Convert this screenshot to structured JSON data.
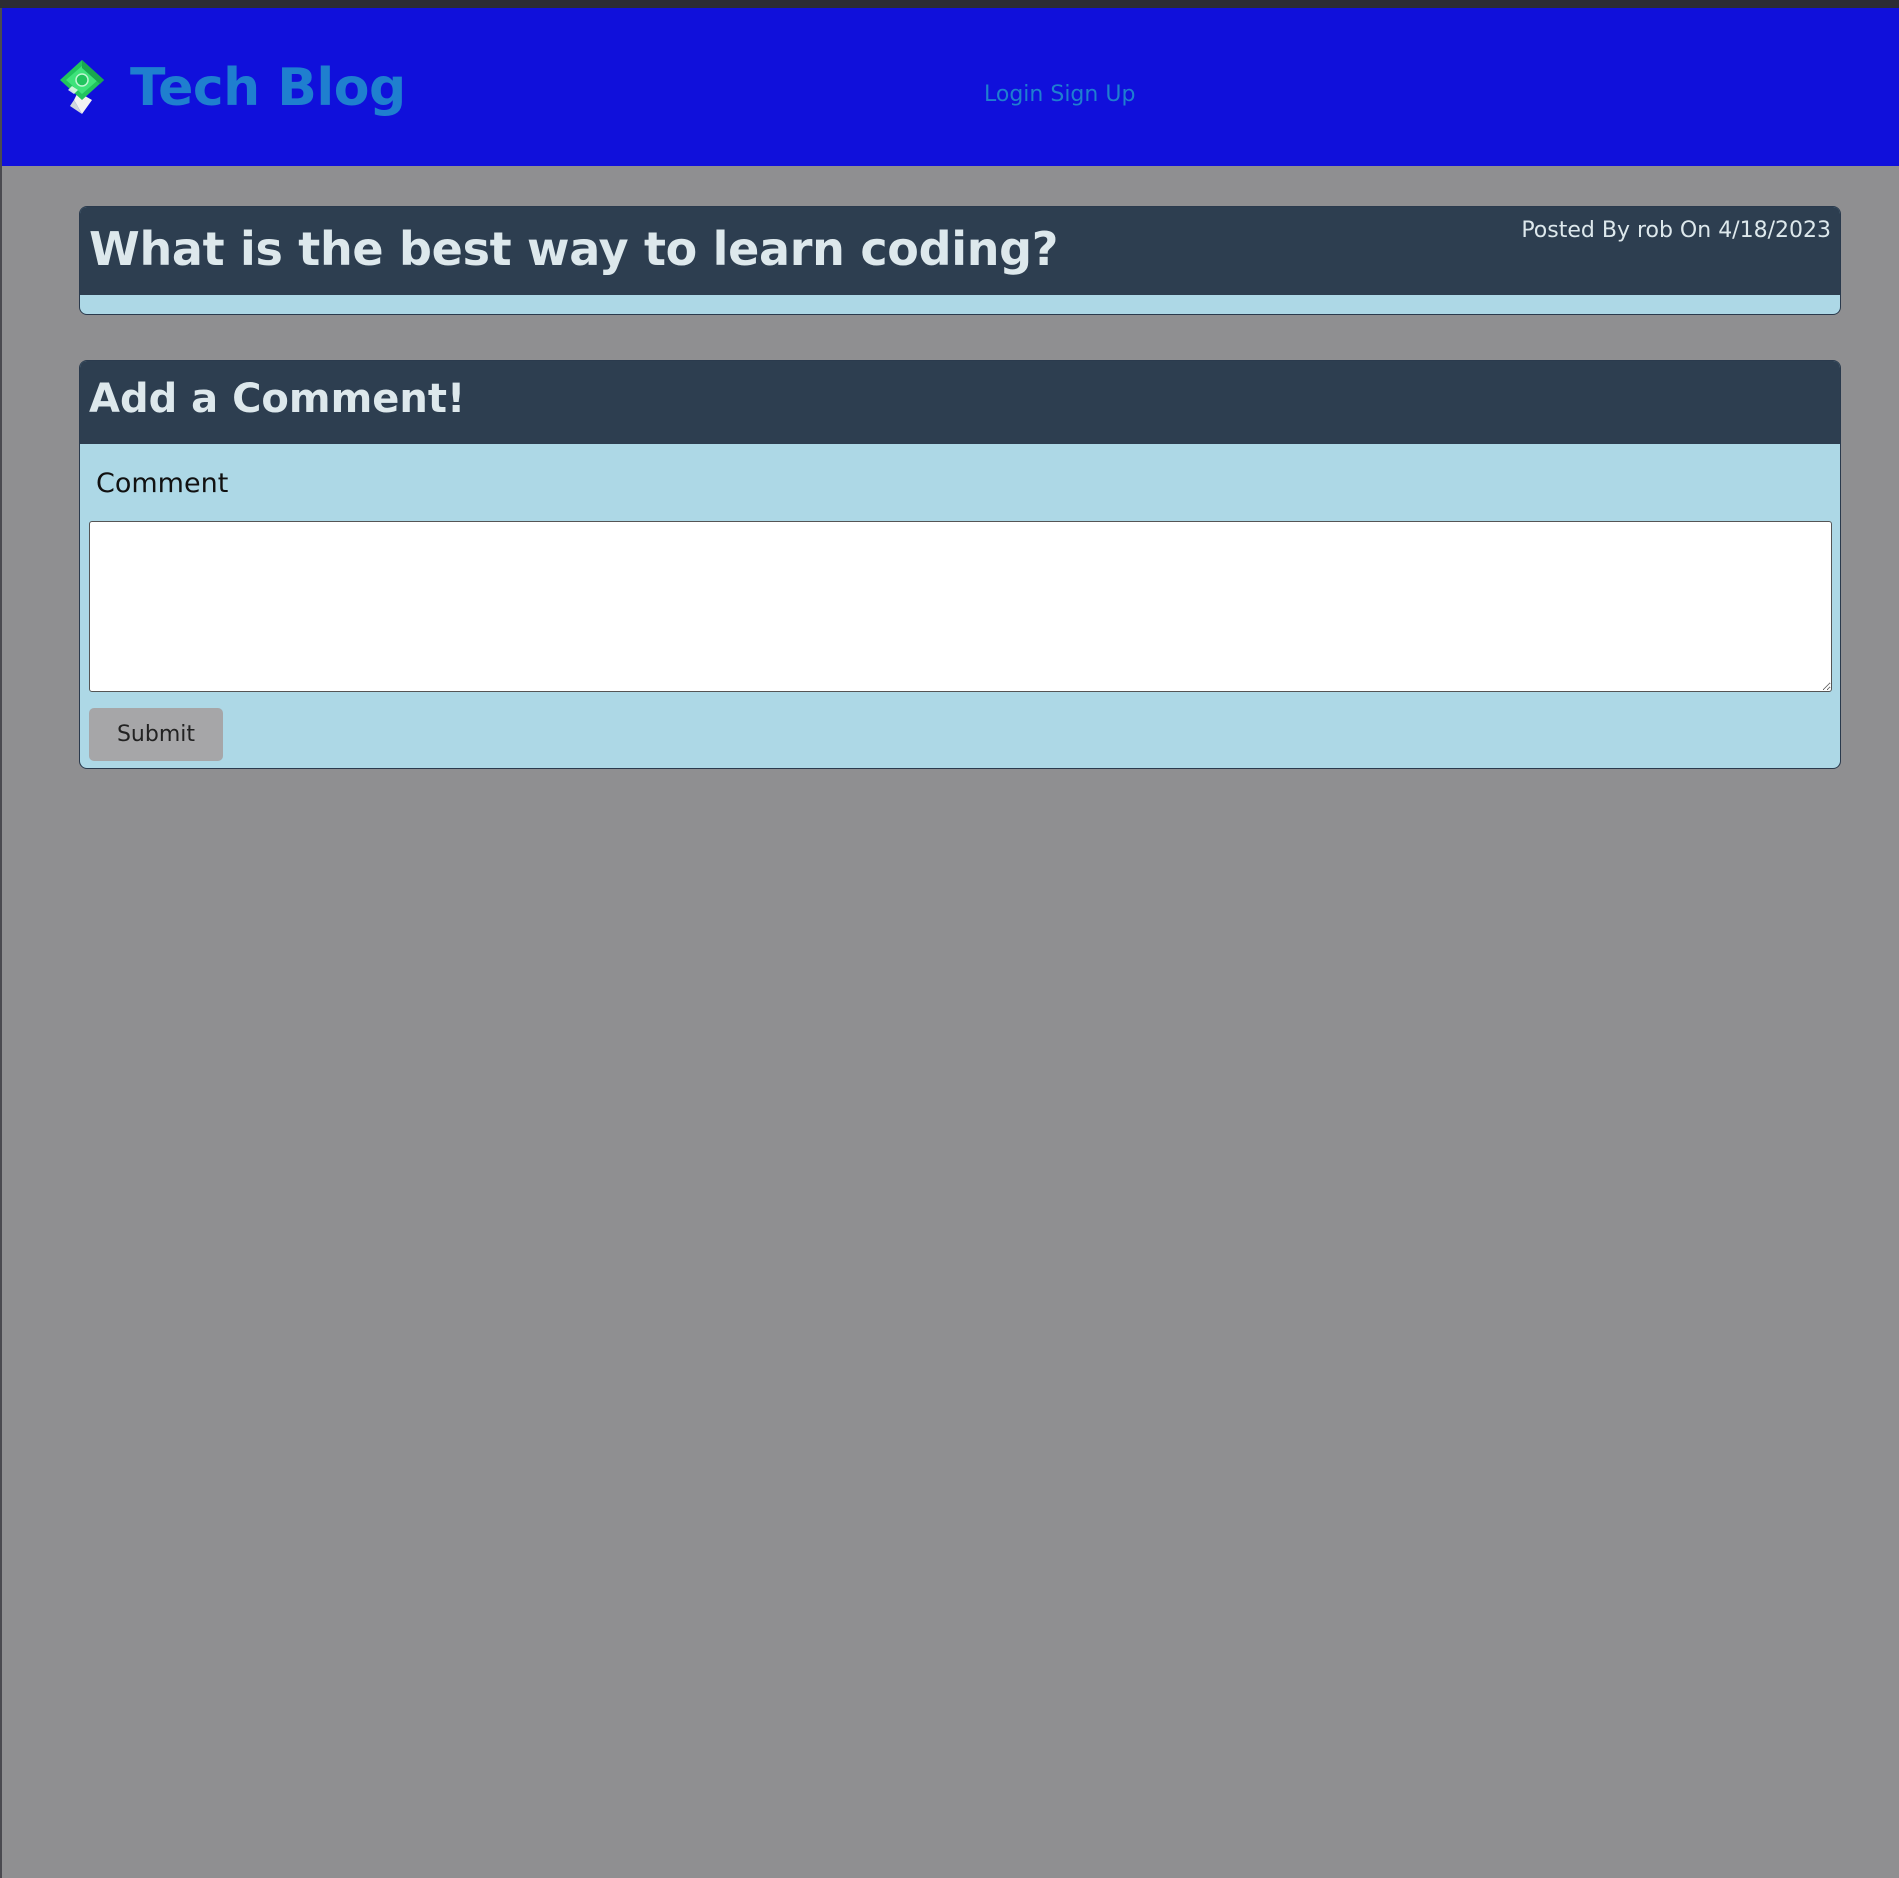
{
  "header": {
    "site_title": "Tech Blog",
    "logo_icon": "money-bill-diamond-icon",
    "nav": {
      "login_label": "Login",
      "signup_label": "Sign Up"
    }
  },
  "post": {
    "title": "What is the best way to learn coding?",
    "meta": "Posted By rob On 4/18/2023"
  },
  "comment_form": {
    "heading": "Add a Comment!",
    "label": "Comment",
    "textarea_value": "",
    "submit_label": "Submit"
  },
  "colors": {
    "header_bg": "#1010db",
    "title_blue": "#1f7fcf",
    "card_header_bg": "#2d3e50",
    "card_body_bg": "#add8e6",
    "page_bg": "#8f8f91",
    "button_bg": "#a6a6a8"
  }
}
